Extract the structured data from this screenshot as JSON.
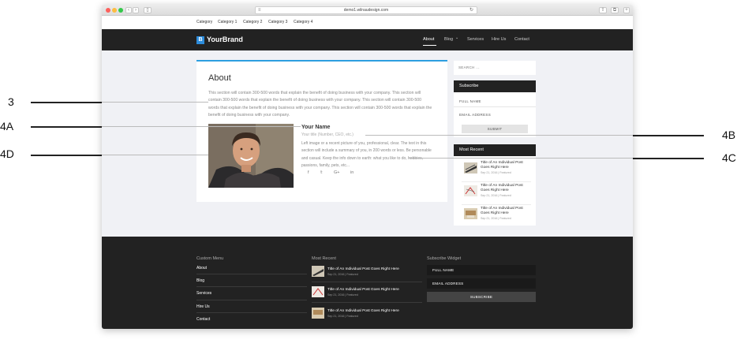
{
  "browser": {
    "url": "demo1.wilnaudesign.com"
  },
  "catbar": {
    "items": [
      "Category",
      "Category 1",
      "Category 2",
      "Category 3",
      "Category 4"
    ]
  },
  "header": {
    "logo_letter": "B",
    "brand": "YourBrand",
    "nav": [
      "About",
      "Blog",
      "Services",
      "Hire Us",
      "Contact"
    ],
    "blog_caret": "⌄"
  },
  "about": {
    "title": "About",
    "text": "This section will contain 300-500 words that explain the benefit of doing business with your company. This section will contain 300-500 words that explain the benefit of doing business with your company. This section will contain 300-500 words that explain the benefit of doing business with your company. This section will contain 300-500 words that explain the benefit of doing business with your company.",
    "name": "Your Name",
    "title_line": "Your title (Number, CEO, etc.)",
    "bio": "Left image or a recent picture of you, professional, clear. The text in this section will include a summary of you, in 200 words or less. Be personable and casual. Keep the info down to earth: what you like to do, hobbies, passions, family, pets, etc..."
  },
  "social_icons": [
    "f",
    "𝕥",
    "G+",
    "in"
  ],
  "sidebar": {
    "search_placeholder": "SEARCH ...",
    "subscribe_title": "Subscribe",
    "full_name": "FULL NAME",
    "email": "EMAIL ADDRESS",
    "submit": "SUBMIT",
    "recent_title": "Most Recent",
    "posts": [
      {
        "title": "Title of An Individual Post Goes Right Here",
        "meta": "Sep 21, 2016 | Featured"
      },
      {
        "title": "Title of An Individual Post Goes Right Here",
        "meta": "Sep 21, 2016 | Featured"
      },
      {
        "title": "Title of An Individual Post Goes Right Here",
        "meta": "Sep 21, 2016 | Featured"
      }
    ]
  },
  "footer": {
    "menu_title": "Custom Menu",
    "menu": [
      "About",
      "Blog",
      "Services",
      "Hire Us",
      "Contact"
    ],
    "recent_title": "Most Recent",
    "posts": [
      {
        "title": "Title of An Individual Post Goes Right Here",
        "meta": "Sep 21, 2016 | Featured"
      },
      {
        "title": "Title of An Individual Post Goes Right Here",
        "meta": "Sep 21, 2016 | Featured"
      },
      {
        "title": "Title of An Individual Post Goes Right Here",
        "meta": "Sep 21, 2016 | Featured"
      }
    ],
    "subscribe_title": "Subscribe Widget",
    "full_name": "FULL NAME",
    "email": "EMAIL ADDRESS",
    "subscribe_btn": "SUBSCRIBE"
  },
  "annotations": [
    "3",
    "4A",
    "4D",
    "4B",
    "4C"
  ],
  "colors": {
    "accent": "#2d9ee0",
    "dark": "#222222",
    "page_bg": "#f0f1f5"
  }
}
